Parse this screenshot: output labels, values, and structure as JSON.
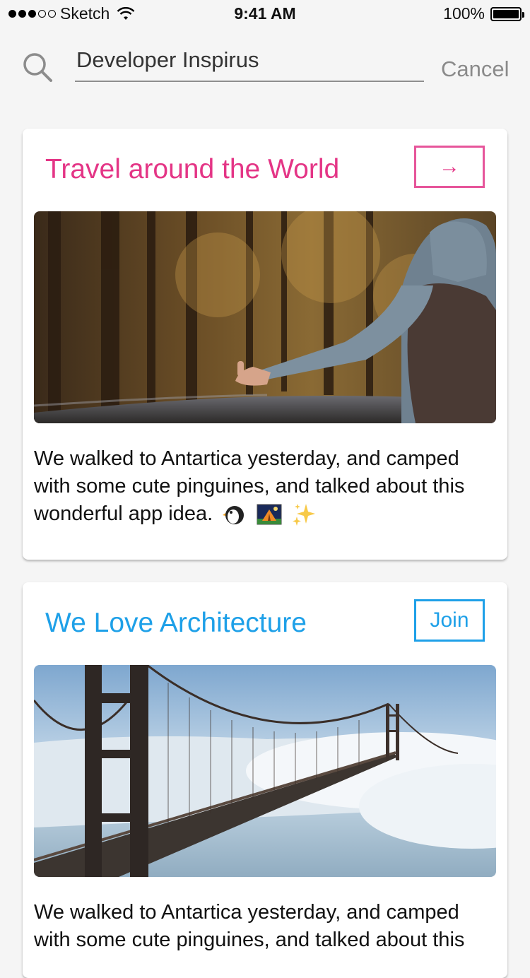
{
  "status_bar": {
    "carrier": "Sketch",
    "time": "9:41 AM",
    "battery": "100%",
    "signal_bars_filled": 3,
    "signal_bars_total": 5
  },
  "search": {
    "value": "Developer Inspirus",
    "cancel_label": "Cancel",
    "icon": "search-icon"
  },
  "cards": [
    {
      "title": "Travel around the World",
      "title_color": "#e43586",
      "button_label": "→",
      "image": "hitchhiker-in-forest",
      "text": "We walked to Antartica yesterday, and camped with some cute pinguines, and talked about this wonderful app idea.",
      "emojis": [
        "penguin",
        "camping",
        "sparkles"
      ]
    },
    {
      "title": "We Love Architecture",
      "title_color": "#1ea0e8",
      "button_label": "Join",
      "image": "golden-gate-bridge-in-fog",
      "text": "We walked to Antartica yesterday, and camped with some cute pinguines, and talked about this"
    }
  ]
}
